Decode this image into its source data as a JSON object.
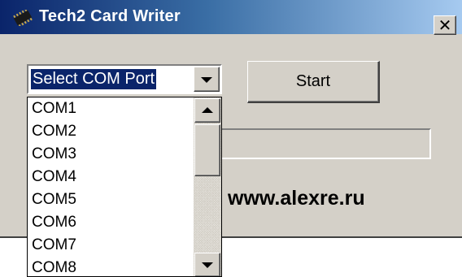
{
  "window": {
    "title": "Tech2 Card Writer",
    "close_label": "✕"
  },
  "com_port": {
    "selected": "Select COM Port",
    "options": [
      "COM1",
      "COM2",
      "COM3",
      "COM4",
      "COM5",
      "COM6",
      "COM7",
      "COM8"
    ]
  },
  "start_button": {
    "label": "Start"
  },
  "footer": {
    "website": "www.alexre.ru"
  },
  "icons": {
    "app": "chip-icon",
    "close": "close-icon",
    "dropdown": "chevron-down-icon",
    "scroll_up": "scroll-up-arrow-icon",
    "scroll_down": "scroll-down-arrow-icon"
  },
  "colors": {
    "titlebar_start": "#0a246a",
    "titlebar_end": "#a6caf0",
    "window_bg": "#d4d0c8",
    "selection_bg": "#0a246a",
    "selection_fg": "#ffffff"
  }
}
